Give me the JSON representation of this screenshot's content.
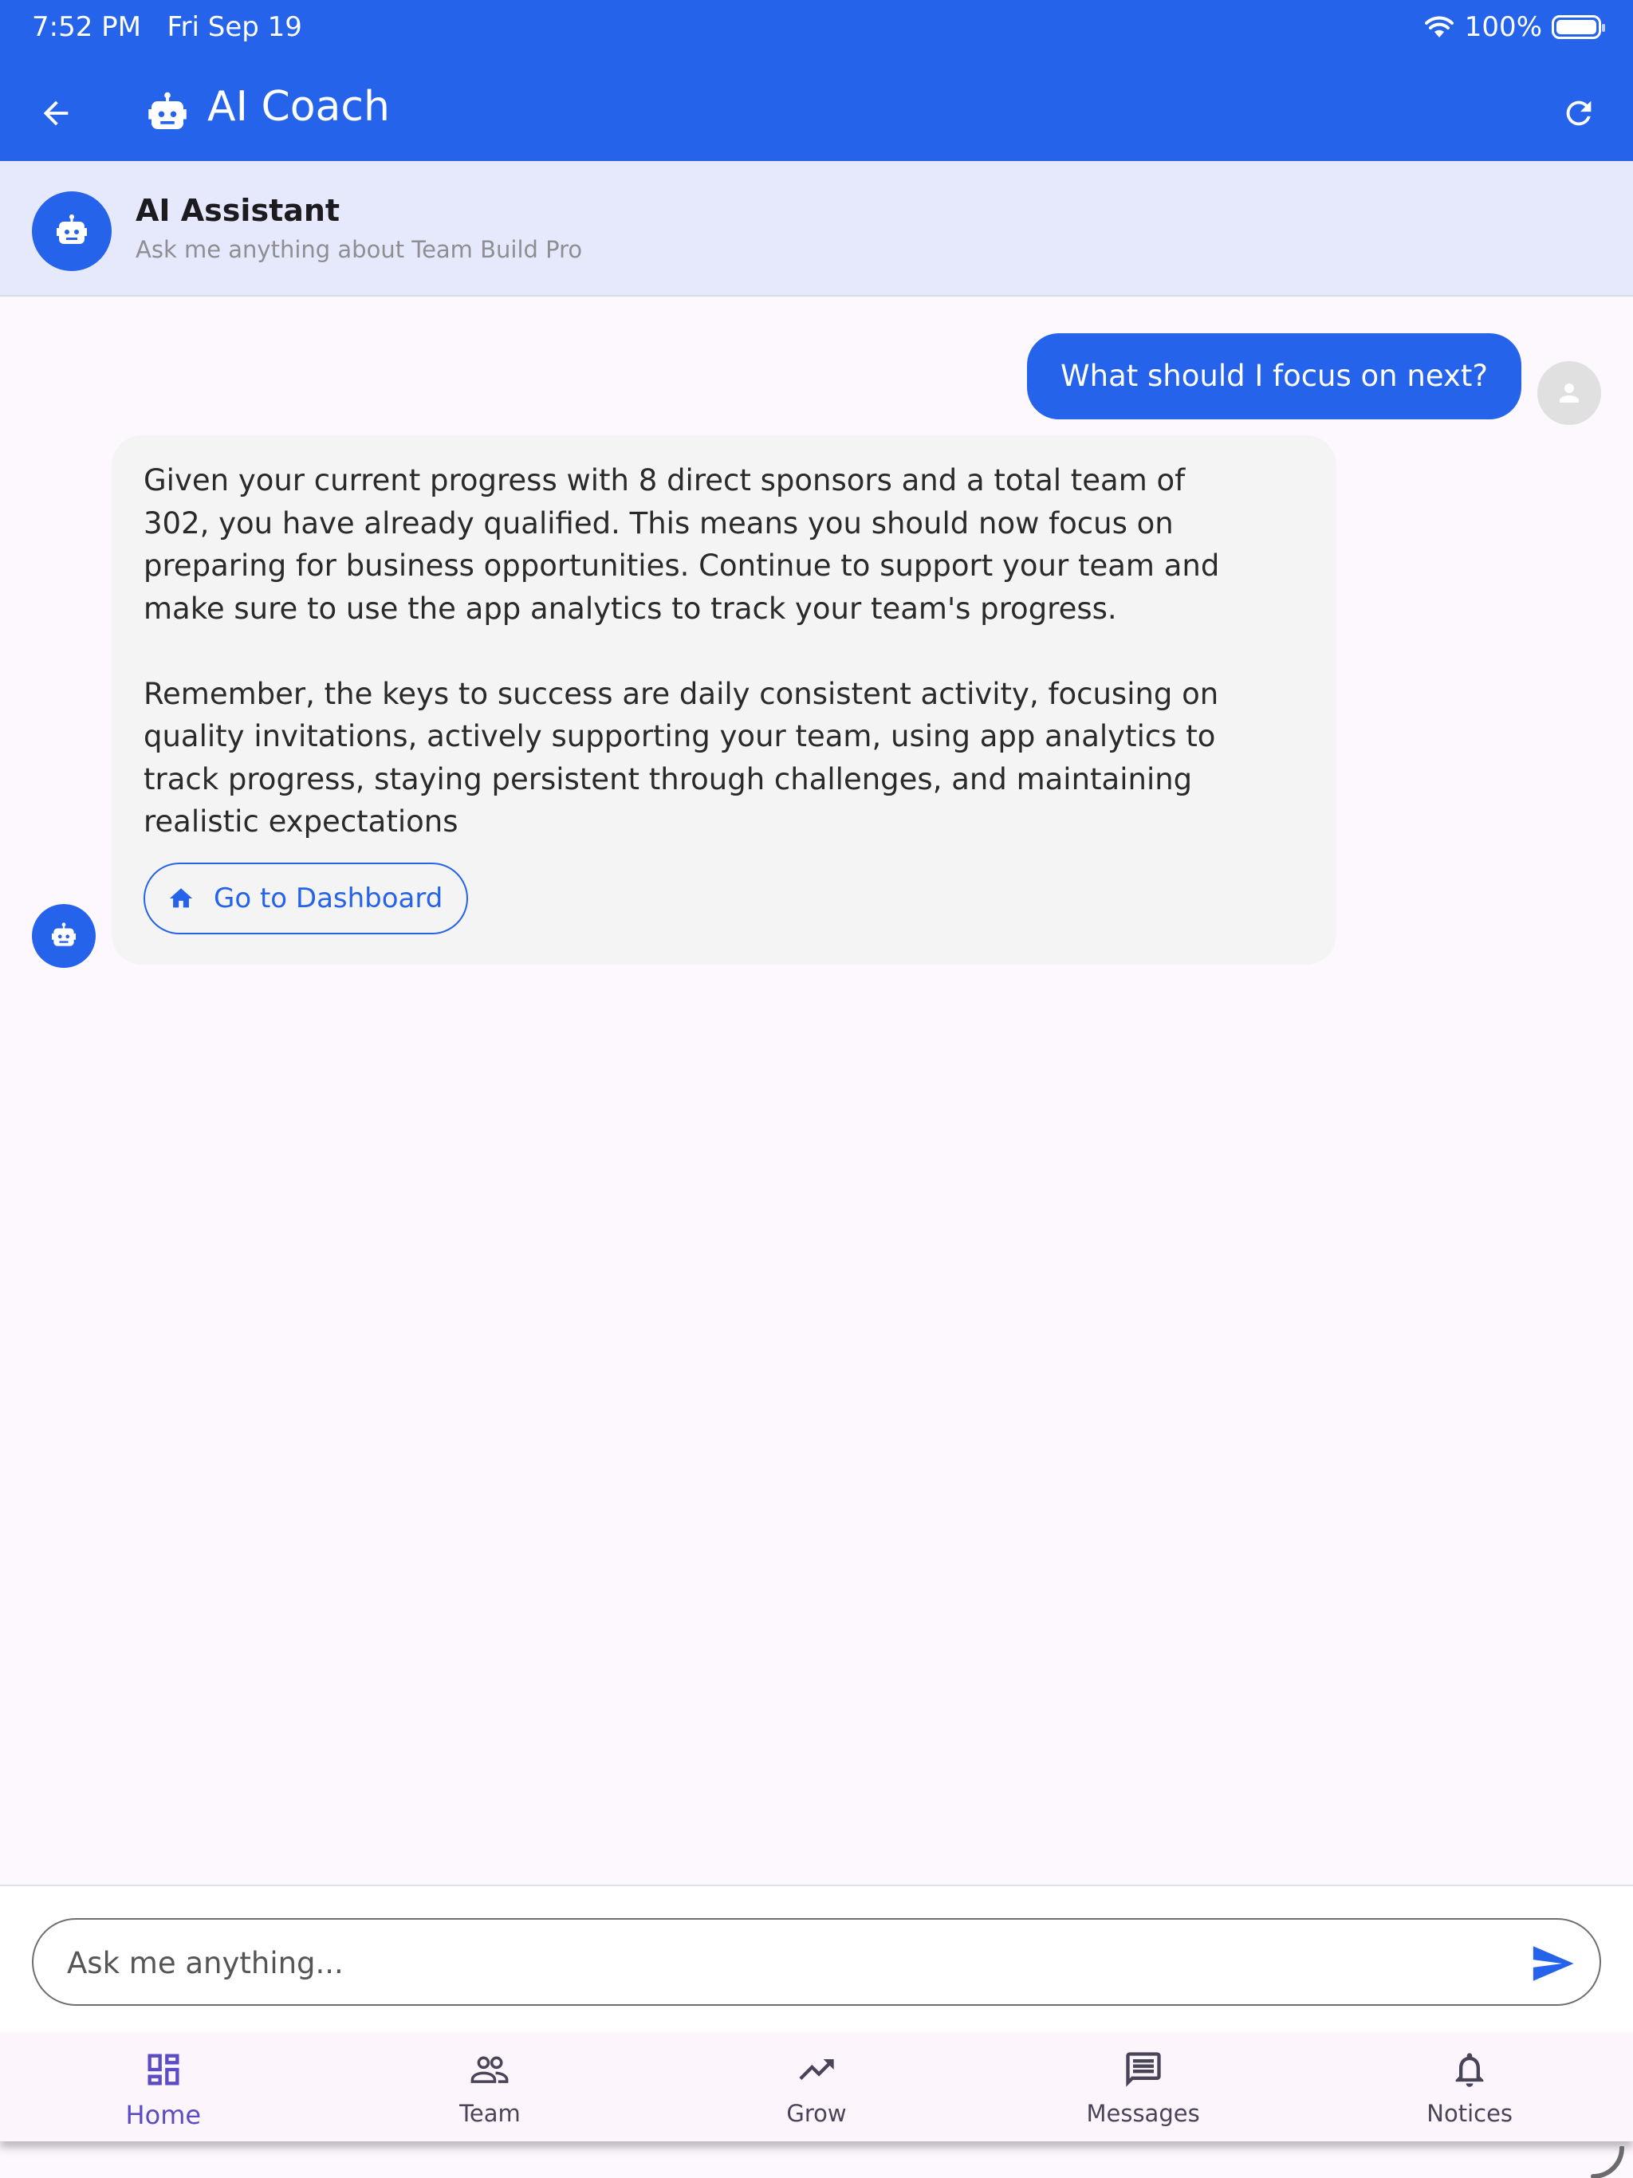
{
  "status_bar": {
    "time": "7:52 PM",
    "date": "Fri Sep 19",
    "battery": "100%"
  },
  "app_bar": {
    "title": "AI Coach"
  },
  "assistant": {
    "name": "AI Assistant",
    "subtitle": "Ask me anything about Team Build Pro"
  },
  "messages": {
    "user": "What should I focus on next?",
    "bot": "Given your current progress with 8 direct sponsors and a total team of\n302, you have already qualified. This means you should now focus on\npreparing for business opportunities. Continue to support your team and\nmake sure to use the app analytics to track your team's progress.\n\nRemember, the keys to success are daily consistent activity, focusing on\nquality invitations, actively supporting your team, using app analytics to\ntrack progress, staying persistent through challenges, and maintaining\nrealistic expectations",
    "action_label": "Go to Dashboard"
  },
  "input": {
    "placeholder": "Ask me anything...",
    "value": ""
  },
  "nav": {
    "items": [
      {
        "label": "Home",
        "icon": "dashboard-icon",
        "active": true
      },
      {
        "label": "Team",
        "icon": "people-icon",
        "active": false
      },
      {
        "label": "Grow",
        "icon": "trending-up-icon",
        "active": false
      },
      {
        "label": "Messages",
        "icon": "message-icon",
        "active": false
      },
      {
        "label": "Notices",
        "icon": "bell-icon",
        "active": false
      }
    ]
  },
  "colors": {
    "primary": "#2563eb",
    "background": "#fdf7fe",
    "header_bg": "#e6e9fb",
    "bot_bubble": "#f4f4f4",
    "nav_active": "#5b4bc4"
  }
}
